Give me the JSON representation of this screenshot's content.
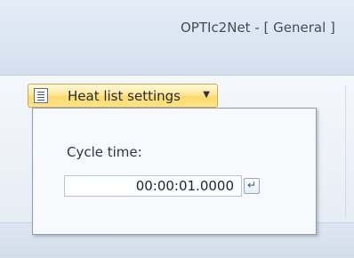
{
  "window": {
    "title": "OPTIc2Net - [ General ]"
  },
  "toolbar": {
    "heat_list_button": {
      "label": "Heat list settings",
      "icon": "list-icon",
      "dropdown_icon": "chevron-down-icon"
    }
  },
  "panel": {
    "cycle_time": {
      "label": "Cycle time:",
      "value": "00:00:01.0000",
      "enter_icon": "enter-icon"
    }
  },
  "colors": {
    "accent_button": "#ffe58c",
    "background": "#dfe8f3"
  }
}
